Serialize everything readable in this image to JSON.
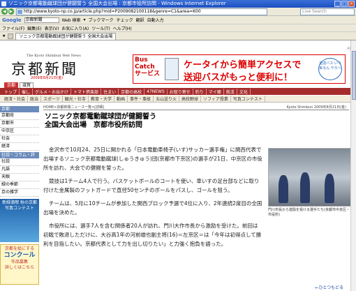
{
  "browser": {
    "title": "ソニック京都電動蹴球団が健闘誓う 全国大会出場 : 京都市役所訪問 - Windows Internet Explorer",
    "nav_back": "◀",
    "nav_forward": "▶",
    "address": "http://www.kyoto-np.co.jp/article.php?mid=P2009082100118&genre=C1&area=K00",
    "live_search": "Live Search",
    "google_label": "Google",
    "google_query": "京都新聞",
    "google_bar": [
      "Web 検索",
      "▾",
      "ブックマーク",
      "チェック",
      "翻訳",
      "自動入力"
    ],
    "menu": [
      "ファイル(F)",
      "編集(E)",
      "表示(V)",
      "お気に入り(A)",
      "ツール(T)",
      "ヘルプ(H)"
    ],
    "tab_label": "ソニック京都電動蹴球団が健闘誓う 全国大会出場"
  },
  "masthead": {
    "sub": "The Kyoto Shimbun Web News",
    "logo": "京都新聞",
    "date": "2009年8月21日(金)",
    "ad_label": "AD"
  },
  "ad": {
    "bus_catch": "Bus Catch サービス",
    "line1": "ケータイから簡単アクセスで",
    "line2": "送迎バスがもっと便利に！",
    "bubble": "送迎バス いつ来るん やろ〜"
  },
  "tabs_region": [
    "京都",
    "滋賀"
  ],
  "nav1": [
    "トップ",
    "催し",
    "グルメ・お出かけ",
    "トマト倶楽部",
    "住まい",
    "京都の高校",
    "47NEWS",
    "お取り寄せ",
    "釣り",
    "マイ郷",
    "就活",
    "文化"
  ],
  "nav2": [
    "経済・社会",
    "政治",
    "スポーツ",
    "観光・社寺",
    "教育・大学",
    "動画",
    "事件・事故",
    "五山送り火",
    "高校野球",
    "ソフィア授業",
    "写真コンテスト"
  ],
  "sidebar": {
    "section1_title": "京都",
    "section2_title": "社説・コラム・評論",
    "links": [
      "京都府",
      "京都市",
      "中京区",
      "社会",
      "経済"
    ],
    "links2": [
      "社説",
      "凡語",
      "天眼",
      "緑の季節",
      "京の雑学"
    ],
    "banner1": "新緑満喫 秋の京都写真コンテスト",
    "banner2_title": "京都を絵にする",
    "banner2_big": "コンクール",
    "banner2_sub": "作品募集",
    "banner2_note": "詳しくはこちら"
  },
  "article": {
    "breadcrumb": "HOME>京都新聞ニュース一覧>[詳細]",
    "credit": "Kyoto Shimbun 2009年8月21日(金)",
    "headline1": "ソニック京都電動蹴球団が健闘誓う",
    "headline2": "全国大会出場　京都市役所訪問",
    "paragraphs": [
      "金沢市で10月24、25日に開かれる「日本電動車椅子(いす)サッカー選手権」に関西代表で出場するソニック京都電動蹴球(しゅうきゅう)団(京都市下京区)の選手が21日、中京区の市役所を訪れ、大会での健闘を誓った。",
      "競技は1チーム4人で行う。バスケットボールのコートを使い、車いすの足台部などに取り付けた金属製のフットガードで直径50センチのボールをパスし、ゴールを狙う。",
      "チームは、5月に10チームが参加した関西ブロック予選で4位に入り、2年連続2度目の全国出場を決めた。",
      "市役所には、選手7人を含む関係者20人が訪れ、門川大作市長から激励を受けた。前回は初戦で敗退しただけに、大谷高1年の河前雄也副主将(16)＝左京区＝は「今年は初得点して勝利を目指したい。京都代表として力を出し切りたい」と力強く抱負を語った。"
    ],
    "caption": "門川市長から激励を受ける選手たち(京都市中京区・市役所)",
    "top_link": "←ひとつもどる"
  }
}
